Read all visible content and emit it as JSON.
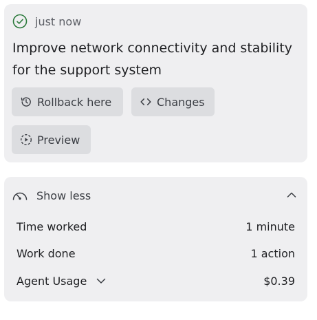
{
  "checkpoint": {
    "status": "just now",
    "title": "Improve network connectivity and stability for the support system",
    "buttons": {
      "rollback": "Rollback here",
      "changes": "Changes",
      "preview": "Preview"
    },
    "icons": {
      "status": "check-circle-icon",
      "rollback": "history-icon",
      "changes": "code-icon",
      "preview": "play-circle-icon"
    },
    "accent_color": "#2b7a3b"
  },
  "summary": {
    "toggle_label": "Show less",
    "toggle_icon": "gauge-icon",
    "stats": [
      {
        "label": "Time worked",
        "value": "1 minute"
      },
      {
        "label": "Work done",
        "value": "1 action"
      },
      {
        "label": "Agent Usage",
        "value": "$0.39"
      }
    ]
  }
}
